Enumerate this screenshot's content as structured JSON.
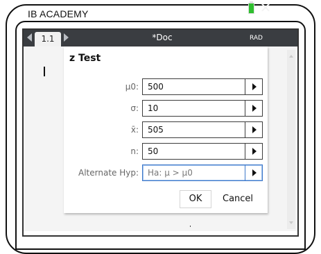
{
  "brand": "IB ACADEMY",
  "titlebar": {
    "tab_label": "1.1",
    "doc_title": "*Doc",
    "angle_mode": "RAD",
    "close_glyph": "✕",
    "battery_color": "#2fbf2f"
  },
  "dialog": {
    "title": "z Test",
    "fields": [
      {
        "label": "μ0:",
        "value": "500"
      },
      {
        "label": "σ:",
        "value": "10"
      },
      {
        "label": "x̄:",
        "value": "505"
      },
      {
        "label": "n:",
        "value": "50"
      },
      {
        "label": "Alternate Hyp:",
        "value": "Ha: μ > μ0"
      }
    ],
    "ok_label": "OK",
    "cancel_label": "Cancel"
  },
  "colors": {
    "titlebar_bg": "#3a3d41",
    "focus_border": "#3e78c9"
  }
}
